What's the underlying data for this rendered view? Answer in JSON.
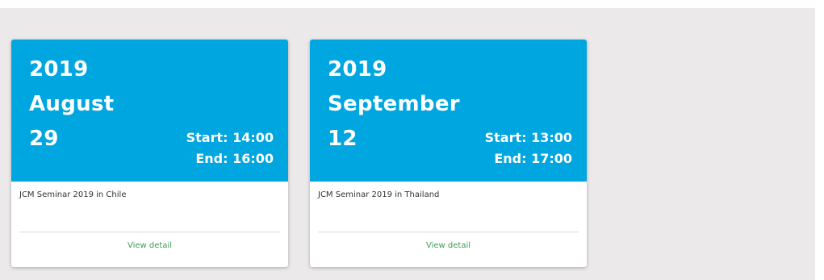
{
  "events": [
    {
      "year": "2019",
      "month": "August",
      "day": "29",
      "start": "Start: 14:00",
      "end": "End: 16:00",
      "title": "JCM Seminar 2019 in Chile",
      "link_label": "View detail"
    },
    {
      "year": "2019",
      "month": "September",
      "day": "12",
      "start": "Start: 13:00",
      "end": "End: 17:00",
      "title": "JCM Seminar 2019 in Thailand",
      "link_label": "View detail"
    }
  ],
  "colors": {
    "header_bg": "#00a6df",
    "link": "#3d9c5b",
    "page_bg": "#ebe9ea"
  }
}
